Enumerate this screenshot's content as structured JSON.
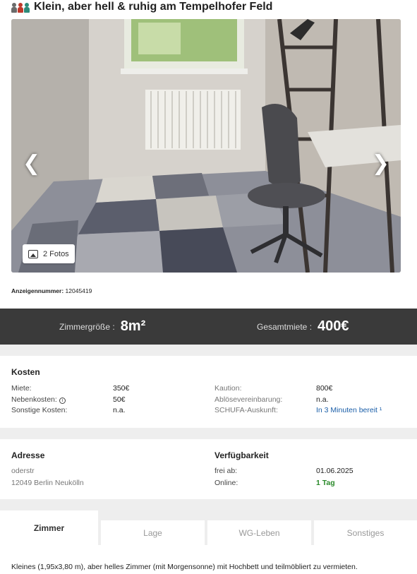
{
  "listing": {
    "title": "Klein, aber hell & ruhig am Tempelhofer Feld",
    "photo_count_label": "2 Fotos",
    "ad_number_label": "Anzeigennummer:",
    "ad_number": "12045419"
  },
  "gallery": {
    "prev_label": "❮",
    "next_label": "❯",
    "icons": {
      "people": "flatmates-icon",
      "photos": "images-icon"
    }
  },
  "key_facts": {
    "room_size_label": "Zimmergröße :",
    "room_size_value": "8m²",
    "total_rent_label": "Gesamtmiete :",
    "total_rent_value": "400€"
  },
  "costs": {
    "title": "Kosten",
    "rows_left": [
      {
        "label": "Miete:",
        "value": "350€"
      },
      {
        "label": "Nebenkosten:",
        "value": "50€"
      },
      {
        "label": "Sonstige Kosten:",
        "value": "n.a."
      }
    ],
    "rows_right": [
      {
        "label": "Kaution:",
        "value": "800€"
      },
      {
        "label": "Ablösevereinbarung:",
        "value": "n.a."
      },
      {
        "label": "SCHUFA-Auskunft:",
        "value": "In 3 Minuten bereit ¹"
      }
    ]
  },
  "address": {
    "title": "Adresse",
    "street": "oderstr",
    "city": "12049 Berlin Neukölln"
  },
  "availability": {
    "title": "Verfügbarkeit",
    "free_from_label": "frei ab:",
    "free_from_value": "01.06.2025",
    "online_label": "Online:",
    "online_value": "1 Tag"
  },
  "tabs": [
    {
      "label": "Zimmer",
      "active": true
    },
    {
      "label": "Lage",
      "active": false
    },
    {
      "label": "WG-Leben",
      "active": false
    },
    {
      "label": "Sonstiges",
      "active": false
    }
  ],
  "description": "Kleines (1,95x3,80 m), aber helles Zimmer (mit Morgensonne) mit Hochbett und teilmöbliert zu vermieten.",
  "colors": {
    "key_bar_bg": "#3a3a3a",
    "link": "#1a5ea8",
    "online_green": "#2a8a2a",
    "section_gap": "#eeeeee"
  }
}
